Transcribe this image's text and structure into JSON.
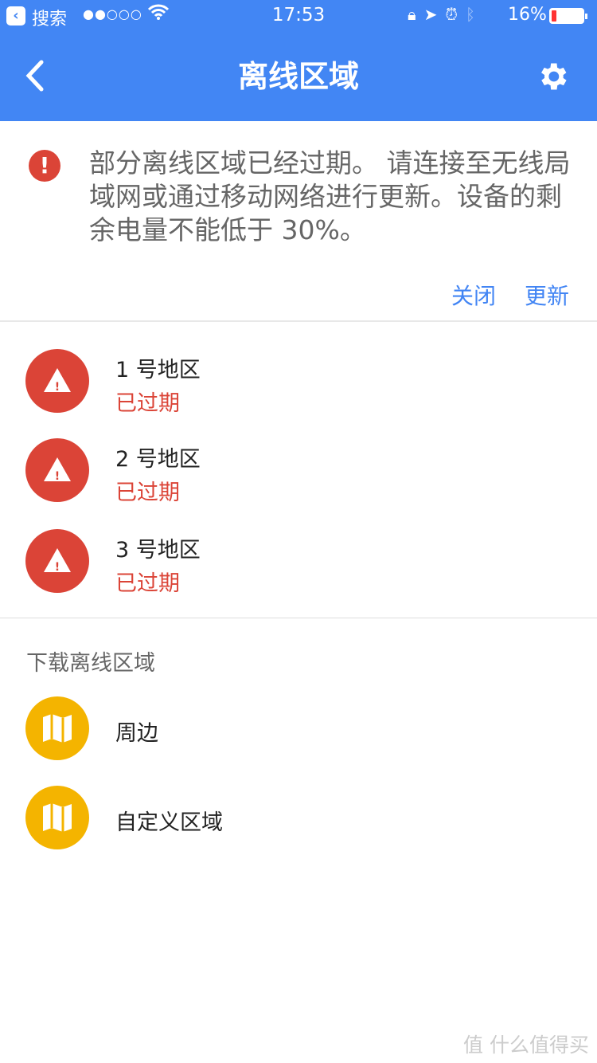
{
  "status_bar": {
    "back_app": "搜索",
    "signal": "●●○○○",
    "time": "17:53",
    "battery_percent": "16%",
    "battery_level": 0.16
  },
  "header": {
    "title": "离线区域"
  },
  "alert": {
    "message": "部分离线区域已经过期。 请连接至无线局域网或通过移动网络进行更新。设备的剩余电量不能低于 30%。",
    "dismiss_label": "关闭",
    "update_label": "更新"
  },
  "regions": [
    {
      "name": "1 号地区",
      "status": "已过期"
    },
    {
      "name": "2 号地区",
      "status": "已过期"
    },
    {
      "name": "3 号地区",
      "status": "已过期"
    }
  ],
  "download": {
    "heading": "下载离线区域",
    "options": [
      {
        "label": "周边"
      },
      {
        "label": "自定义区域"
      }
    ]
  },
  "watermark": "值 什么值得买",
  "colors": {
    "header": "#4286f4",
    "expired": "#db4437",
    "map": "#f4b400",
    "link": "#4285f4"
  }
}
